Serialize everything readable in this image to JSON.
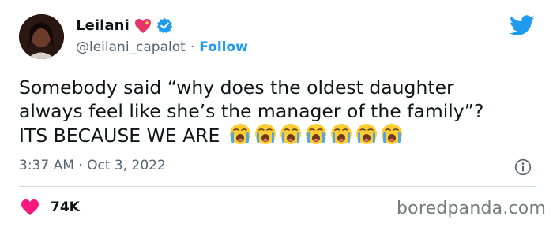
{
  "author": {
    "name": "Leilani",
    "handle": "@leilani_capalot",
    "separator": "·",
    "follow_label": "Follow"
  },
  "tweet": {
    "line1": "Somebody said “why does the oldest daughter",
    "line2": "always feel like she’s the manager of the family”?",
    "line3": "ITS BECAUSE WE ARE",
    "emoji_count": 7,
    "emoji": "loudly-crying-face-icon"
  },
  "meta": {
    "timestamp": "3:37 AM · Oct 3, 2022"
  },
  "engagement": {
    "likes": "74K"
  },
  "watermark": "boredpanda.com",
  "colors": {
    "twitter_blue": "#1d9bf0",
    "like_pink": "#f91880",
    "muted_text": "#536471"
  }
}
